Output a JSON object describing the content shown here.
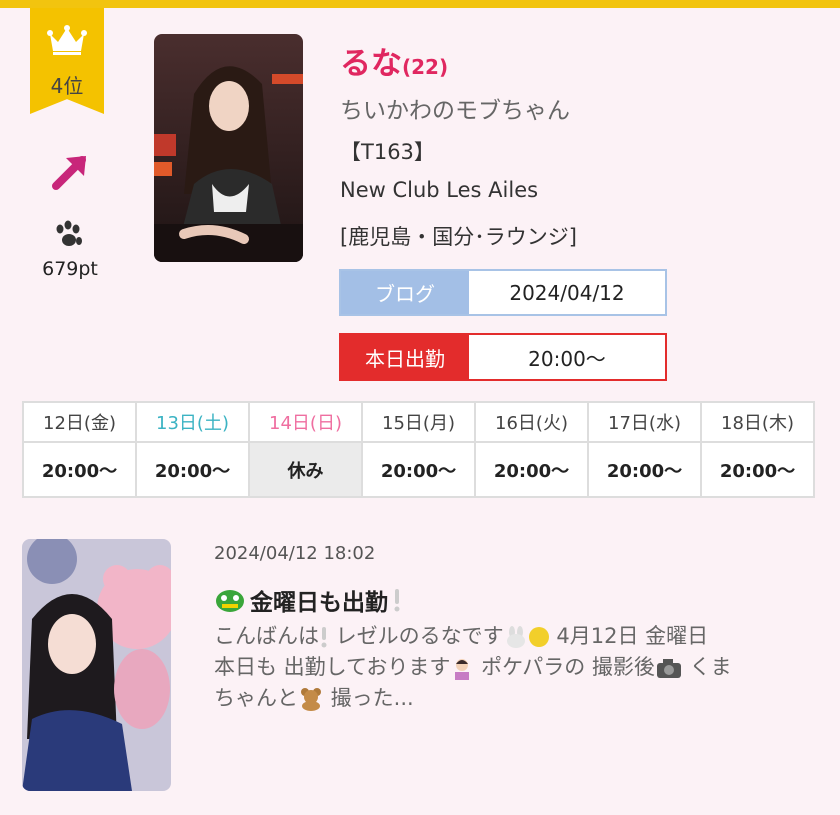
{
  "colors": {
    "accent": "#e02760",
    "gold": "#f4c200",
    "blog": "#a3bfe6",
    "work": "#e32c2c",
    "saturday": "#3bb3c3",
    "sunday": "#ef6ea0"
  },
  "rank": {
    "label": "4位",
    "crown_icon": "crown-icon",
    "trend_icon": "trend-up-arrow-icon",
    "paw_icon": "paw-icon",
    "points": "679pt"
  },
  "profile": {
    "name": "るな",
    "age": "(22)",
    "catchphrase": "ちいかわのモブちゃん",
    "height": "【T163】",
    "club": "New Club Les Ailes",
    "area": "[鹿児島・国分･ラウンジ]"
  },
  "blog": {
    "label": "ブログ",
    "date": "2024/04/12"
  },
  "today": {
    "label": "本日出勤",
    "time": "20:00〜"
  },
  "schedule": {
    "days": [
      "12日(金)",
      "13日(土)",
      "14日(日)",
      "15日(月)",
      "16日(火)",
      "17日(水)",
      "18日(木)"
    ],
    "times": [
      "20:00〜",
      "20:00〜",
      "休み",
      "20:00〜",
      "20:00〜",
      "20:00〜",
      "20:00〜"
    ]
  },
  "post": {
    "timestamp": "2024/04/12 18:02",
    "title": "金曜日も出勤",
    "body_line1a": "こんばんは",
    "body_line1b": " レゼルのるなです",
    "body_line1c": " 4月12日 金曜日",
    "body_line2a": "本日も 出勤しております",
    "body_line2b": " ポケパラの 撮影後",
    "body_line2c": " くま",
    "body_line3a": "ちゃんと",
    "body_line3b": " 撮った..."
  }
}
